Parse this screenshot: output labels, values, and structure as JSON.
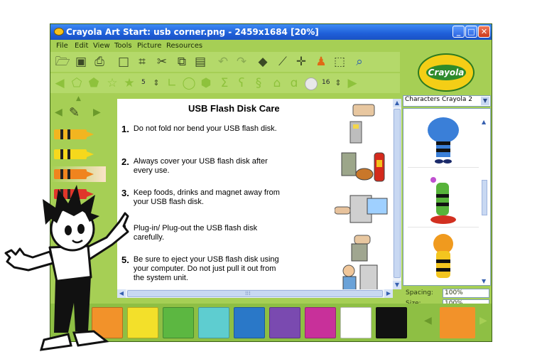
{
  "window": {
    "title": "Crayola Art Start: usb corner.png - 2459x1684 [20%]",
    "buttons": {
      "minimize": "_",
      "maximize": "□",
      "close": "✕"
    }
  },
  "menu": {
    "items": [
      "File",
      "Edit",
      "View",
      "Tools",
      "Picture",
      "Resources"
    ]
  },
  "toolbar": {
    "row1_icons": [
      "open-folder-icon",
      "save-icon",
      "print-icon",
      "new-page-icon",
      "crop-icon",
      "scissors-icon",
      "copy-icon",
      "paste-icon",
      "undo-icon",
      "redo-icon",
      "eraser-icon",
      "eyedropper-icon",
      "crosshair-icon",
      "stamp-icon",
      "select-icon",
      "magnifier-icon"
    ],
    "brush_size": "5",
    "shape_size": "16"
  },
  "brand": {
    "logo_text": "Crayola"
  },
  "crayons": [
    {
      "color": "#f2b520"
    },
    {
      "color": "#f6d81c"
    },
    {
      "color": "#f0841e"
    },
    {
      "color": "#e0362a"
    }
  ],
  "canvas": {
    "heading": "USB Flash Disk Care",
    "steps": [
      {
        "num": "1.",
        "text": "Do not fold nor bend your USB flash disk."
      },
      {
        "num": "2.",
        "text": "Always cover your USB flash disk after every use."
      },
      {
        "num": "3.",
        "text": "Keep foods, drinks and magnet away from your USB flash disk."
      },
      {
        "num": "4.",
        "text": "Plug-in/ Plug-out the USB flash disk carefully."
      },
      {
        "num": "5.",
        "text": "Be sure to eject your USB flash disk using your computer. Do not just pull it out from the system unit."
      }
    ]
  },
  "panel": {
    "dropdown": "Characters Crayola 2",
    "spacing_label": "Spacing:",
    "spacing_value": "100%",
    "size_label": "Size:",
    "size_value": "100%",
    "characters": [
      "blue-elephant-character",
      "green-frog-character",
      "orange-lion-character"
    ]
  },
  "palette": {
    "colors": [
      "#f2922a",
      "#f3e02a",
      "#5cb741",
      "#5ecdd0",
      "#2a78c8",
      "#7a4ab0",
      "#c8309a",
      "#ffffff",
      "#111111"
    ],
    "selected": "#f2922a"
  }
}
